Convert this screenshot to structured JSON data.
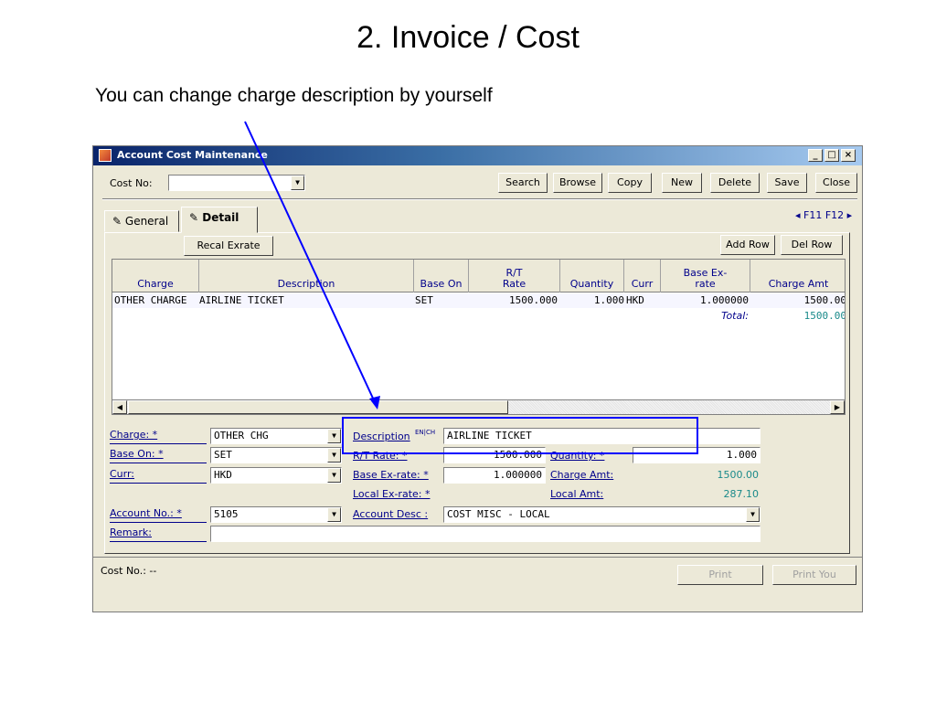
{
  "slide": {
    "title": "2. Invoice / Cost",
    "subtitle": "You can change charge description by yourself"
  },
  "window": {
    "title": "Account Cost Maintenance",
    "controls": {
      "minimize": "_",
      "maximize": "□",
      "close": "×"
    }
  },
  "toolbar": {
    "cost_no_label": "Cost No:",
    "cost_no_value": "",
    "buttons": [
      "Search",
      "Browse",
      "Copy",
      "New",
      "Delete",
      "Save",
      "Close"
    ]
  },
  "tabs": {
    "general": "General",
    "detail": "Detail",
    "nav": "◂ F11 F12 ▸"
  },
  "detail": {
    "recal_button": "Recal Exrate",
    "add_row_button": "Add Row",
    "del_row_button": "Del Row"
  },
  "grid": {
    "columns": [
      "Charge",
      "Description",
      "Base On",
      "R/T Rate",
      "Quantity",
      "Curr",
      "Base Ex-rate",
      "Charge Amt"
    ],
    "rows": [
      {
        "charge": "OTHER CHARGE",
        "description": "AIRLINE TICKET",
        "base_on": "SET",
        "rate": "1500.000",
        "quantity": "1.000",
        "curr": "HKD",
        "ex_rate": "1.000000",
        "charge_amt": "1500.00"
      }
    ],
    "total_label": "Total:",
    "total_value": "1500.00"
  },
  "form": {
    "charge_label": "Charge: *",
    "charge_value": "OTHER CHG",
    "base_on_label": "Base On: *",
    "base_on_value": "SET",
    "curr_label": "Curr:",
    "curr_value": "HKD",
    "account_no_label": "Account No.: *",
    "account_no_value": "5105",
    "remark_label": "Remark:",
    "remark_value": "",
    "description_label": "Description",
    "description_lang": "EN|CH",
    "description_value": "AIRLINE TICKET",
    "rt_rate_label": "R/T Rate: *",
    "rt_rate_value": "1500.000",
    "quantity_label": "Quantity: *",
    "quantity_value": "1.000",
    "base_exrate_label": "Base Ex-rate: *",
    "base_exrate_value": "1.000000",
    "charge_amt_label": "Charge Amt:",
    "charge_amt_value": "1500.00",
    "local_exrate_label": "Local Ex-rate: *",
    "local_amt_label": "Local Amt:",
    "local_amt_value": "287.10",
    "account_desc_label": "Account Desc :",
    "account_desc_value": "COST MISC - LOCAL"
  },
  "footer": {
    "cost_no_text": "Cost No.: --",
    "print_button": "Print",
    "print_you_button": "Print You"
  },
  "colors": {
    "annotation": "#0000ff",
    "teal_value": "#1a8a8a",
    "label_blue": "#00008b"
  }
}
